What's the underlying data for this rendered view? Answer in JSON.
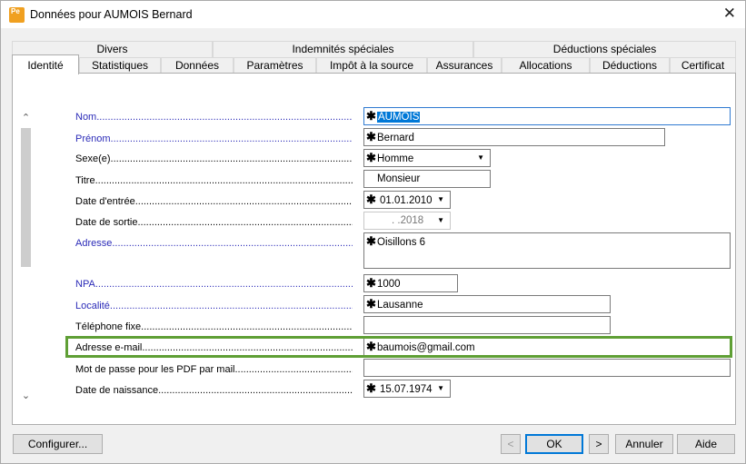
{
  "window": {
    "title": "Données pour AUMOIS Bernard",
    "close_glyph": "✕",
    "app_icon_text": "Pe"
  },
  "tabs": {
    "row_top": [
      "Divers",
      "Indemnités spéciales",
      "Déductions spéciales"
    ],
    "row_bottom": [
      "Identité",
      "Statistiques",
      "Données",
      "Paramètres",
      "Impôt à la source",
      "Assurances",
      "Allocations",
      "Déductions",
      "Certificat"
    ],
    "active": "Identité"
  },
  "scroll": {
    "up_glyph": "⌃",
    "down_glyph": "⌄"
  },
  "form": {
    "nom": {
      "label": "Nom",
      "value": "AUMOIS",
      "required": true
    },
    "prenom": {
      "label": "Prénom",
      "value": "Bernard",
      "required": true
    },
    "sexe": {
      "label": "Sexe(e)",
      "value": "Homme",
      "required": true
    },
    "titre": {
      "label": "Titre",
      "value": "Monsieur",
      "required": false
    },
    "date_entree": {
      "label": "Date d'entrée",
      "value": "01.01.2010",
      "required": true
    },
    "date_sortie": {
      "label": "Date de sortie",
      "value": ".      .2018",
      "required": false
    },
    "adresse": {
      "label": "Adresse",
      "value": "Oisillons 6",
      "required": true
    },
    "npa": {
      "label": "NPA",
      "value": "1000",
      "required": true
    },
    "localite": {
      "label": "Localité",
      "value": "Lausanne",
      "required": true
    },
    "telephone": {
      "label": "Téléphone fixe",
      "value": "",
      "required": false
    },
    "email": {
      "label": "Adresse e-mail",
      "value": "baumois@gmail.com",
      "required": true
    },
    "mot_de_passe": {
      "label": "Mot de passe pour les PDF par mail",
      "value": "",
      "required": false
    },
    "naissance": {
      "label": "Date de naissance",
      "value": "15.07.1974",
      "required": true
    }
  },
  "required_marker": "✱",
  "dropdown_glyph": "▼",
  "dots": "........................................................................................................................................",
  "buttons": {
    "configurer": "Configurer...",
    "prev": "<",
    "ok": "OK",
    "next": ">",
    "annuler": "Annuler",
    "aide": "Aide"
  },
  "colors": {
    "required_label": "#2b2bb8",
    "highlight": "#5f9f35",
    "selection": "#0078d7"
  }
}
